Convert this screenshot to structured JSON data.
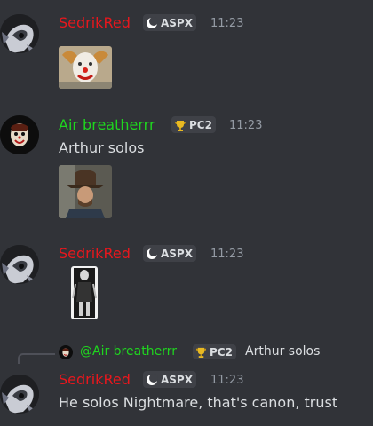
{
  "colors": {
    "background": "#313338",
    "sedrik_name": "#e8171d",
    "air_name": "#1fd51f",
    "mention": "#1fd51f",
    "timestamp": "#949ba4",
    "tag_bg": "#3f4147"
  },
  "messages": [
    {
      "author": "SedrikRed",
      "tag": {
        "icon": "moon-orb-icon",
        "label": "ASPX"
      },
      "time": "11:23",
      "attachment": "clown-mask-image"
    },
    {
      "author": "Air breatherrr",
      "tag": {
        "icon": "trophy-icon",
        "label": "PC2"
      },
      "time": "11:23",
      "text": "Arthur solos",
      "attachment": "cowboy-hat-image"
    },
    {
      "author": "SedrikRed",
      "tag": {
        "icon": "moon-orb-icon",
        "label": "ASPX"
      },
      "time": "11:23",
      "attachment": "tall-figure-image"
    },
    {
      "reply": {
        "mention": "@Air breatherrr",
        "tag": {
          "icon": "trophy-icon",
          "label": "PC2"
        },
        "text": "Arthur solos"
      },
      "author": "SedrikRed",
      "tag": {
        "icon": "moon-orb-icon",
        "label": "ASPX"
      },
      "time": "11:23",
      "text": "He solos Nightmare, that's canon, trust"
    }
  ]
}
